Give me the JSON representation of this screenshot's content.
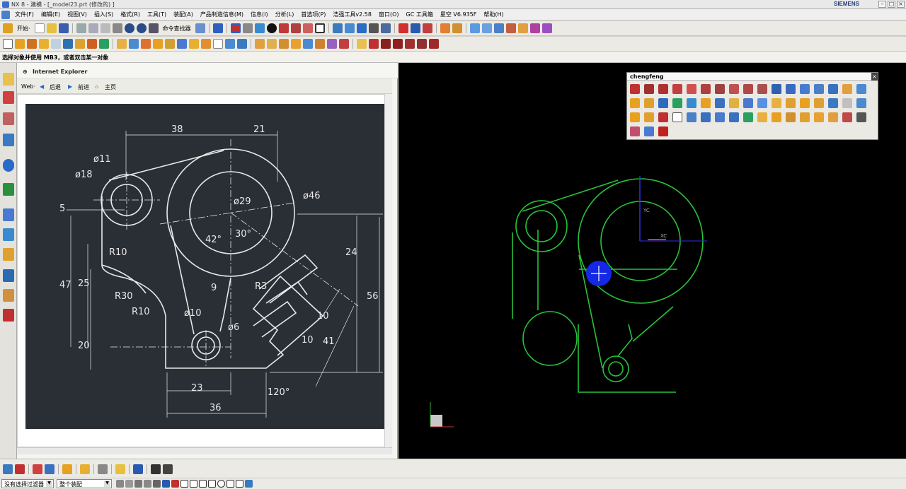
{
  "window": {
    "title": "NX 8 - 建模 - [_model23.prt (修改的) ]",
    "brand": "SIEMENS"
  },
  "menu": [
    "文件(F)",
    "编辑(E)",
    "视图(V)",
    "插入(S)",
    "格式(R)",
    "工具(T)",
    "装配(A)",
    "产品制造信息(M)",
    "信息(I)",
    "分析(L)",
    "首选项(P)",
    "浩强工具v2.58",
    "窗口(O)",
    "GC 工具箱",
    "星空 V6.935F",
    "帮助(H)"
  ],
  "toolbar": {
    "start_label": "开始·",
    "command_finder_label": "命令查找器"
  },
  "status": {
    "prompt": "选择对象并使用 MB3，或者双击某一对象"
  },
  "browser": {
    "title": "Internet Explorer",
    "web_label": "Web·",
    "back_label": "后退",
    "forward_label": "前进",
    "home_label": "主页"
  },
  "drawing": {
    "dims": [
      "38",
      "21",
      "ø11",
      "ø18",
      "5",
      "ø29",
      "ø46",
      "42°",
      "30°",
      "R10",
      "47",
      "25",
      "R30",
      "R10",
      "9",
      "R3",
      "24",
      "56",
      "ø10",
      "ø6",
      "10",
      "10",
      "41",
      "20",
      "23",
      "36",
      "120°"
    ]
  },
  "palette": {
    "title": "chengfeng"
  },
  "graphics": {
    "axis_labels": [
      "YC",
      "XC"
    ]
  },
  "selection_bar": {
    "filter_value": "没有选择过滤器",
    "scope_value": "整个装配"
  },
  "colors": {
    "sketch": "#27c43a",
    "background": "#000000",
    "drawing_bg": "#2a2e35",
    "highlight": "#1428e6"
  }
}
